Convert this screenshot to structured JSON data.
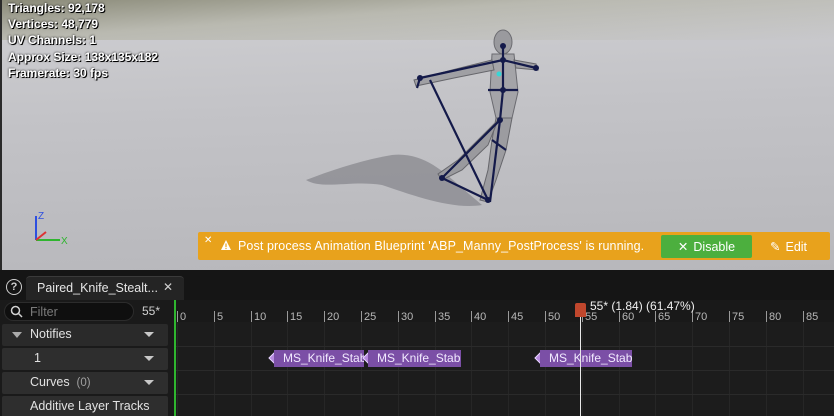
{
  "viewport": {
    "stats": [
      "Triangles: 92,178",
      "Vertices: 48,779",
      "UV Channels: 1",
      "Approx Size: 138x135x182",
      "Framerate: 30 fps"
    ],
    "gizmo": {
      "z": "Z",
      "x": "X"
    }
  },
  "banner": {
    "message": "Post process Animation Blueprint 'ABP_Manny_PostProcess' is running.",
    "disable_label": "Disable",
    "edit_label": "Edit",
    "color": "#e8a21c"
  },
  "tab": {
    "label": "Paired_Knife_Stealt..."
  },
  "filter": {
    "placeholder": "Filter",
    "frame": "55*"
  },
  "tracks": {
    "notifies": "Notifies",
    "notify_track_1": "1",
    "curves": "Curves",
    "curves_count": "(0)",
    "additive": "Additive Layer Tracks"
  },
  "timeline": {
    "ticks": [
      "0",
      "5",
      "10",
      "15",
      "20",
      "25",
      "30",
      "35",
      "40",
      "45",
      "50",
      "55",
      "60",
      "65",
      "70",
      "75",
      "80",
      "85"
    ],
    "playhead": "55* (1.84) (61.47%)",
    "notifies": [
      {
        "label": "MS_Knife_Stab"
      },
      {
        "label": "MS_Knife_Stab"
      },
      {
        "label": "MS_Knife_Stab"
      }
    ]
  }
}
